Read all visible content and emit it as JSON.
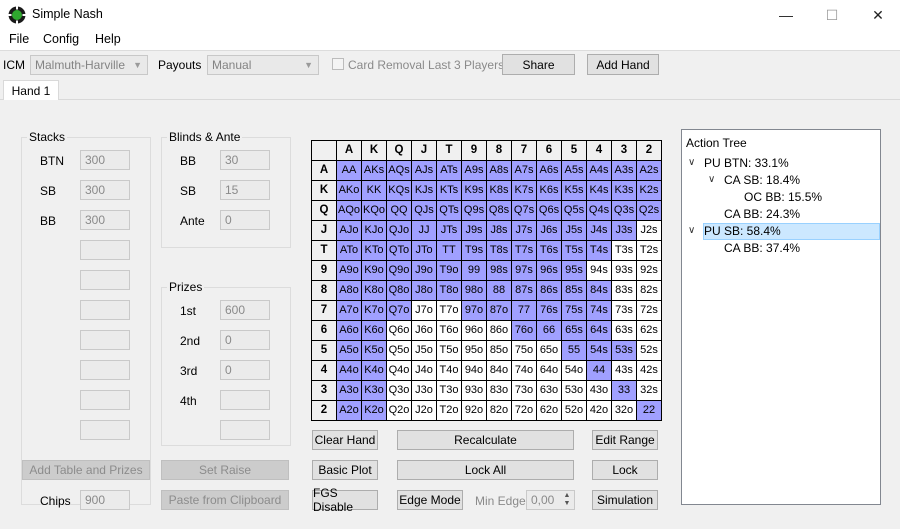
{
  "window": {
    "title": "Simple Nash",
    "minimize": "—",
    "maximize": "☐",
    "close": "✕"
  },
  "menu": [
    "File",
    "Config",
    "Help"
  ],
  "toolbar": {
    "icm_label": "ICM",
    "icm_value": "Malmuth-Harville",
    "payouts_label": "Payouts",
    "payouts_value": "Manual",
    "card_removal_label": "Card Removal Last 3 Players",
    "card_removal_checked": false,
    "share_label": "Share",
    "add_hand_label": "Add Hand"
  },
  "tabs": [
    "Hand 1"
  ],
  "stacks": {
    "title": "Stacks",
    "rows": [
      {
        "label": "BTN",
        "value": "300"
      },
      {
        "label": "SB",
        "value": "300"
      },
      {
        "label": "BB",
        "value": "300"
      },
      {
        "label": "",
        "value": ""
      },
      {
        "label": "",
        "value": ""
      },
      {
        "label": "",
        "value": ""
      },
      {
        "label": "",
        "value": ""
      },
      {
        "label": "",
        "value": ""
      },
      {
        "label": "",
        "value": ""
      },
      {
        "label": "",
        "value": ""
      }
    ]
  },
  "blinds": {
    "title": "Blinds & Ante",
    "rows": [
      {
        "label": "BB",
        "value": "30"
      },
      {
        "label": "SB",
        "value": "15"
      },
      {
        "label": "Ante",
        "value": "0"
      }
    ]
  },
  "prizes": {
    "title": "Prizes",
    "rows": [
      {
        "label": "1st",
        "value": "600"
      },
      {
        "label": "2nd",
        "value": "0"
      },
      {
        "label": "3rd",
        "value": "0"
      },
      {
        "label": "4th",
        "value": ""
      },
      {
        "label": "",
        "value": ""
      }
    ]
  },
  "left_buttons": {
    "add_table": "Add Table and Prizes",
    "set_raise": "Set Raise",
    "chips_label": "Chips",
    "chips_value": "900",
    "paste": "Paste from Clipboard"
  },
  "grid": {
    "ranks": [
      "A",
      "K",
      "Q",
      "J",
      "T",
      "9",
      "8",
      "7",
      "6",
      "5",
      "4",
      "3",
      "2"
    ],
    "cells": [
      [
        "AA",
        "AKs",
        "AQs",
        "AJs",
        "ATs",
        "A9s",
        "A8s",
        "A7s",
        "A6s",
        "A5s",
        "A4s",
        "A3s",
        "A2s"
      ],
      [
        "AKo",
        "KK",
        "KQs",
        "KJs",
        "KTs",
        "K9s",
        "K8s",
        "K7s",
        "K6s",
        "K5s",
        "K4s",
        "K3s",
        "K2s"
      ],
      [
        "AQo",
        "KQo",
        "QQ",
        "QJs",
        "QTs",
        "Q9s",
        "Q8s",
        "Q7s",
        "Q6s",
        "Q5s",
        "Q4s",
        "Q3s",
        "Q2s"
      ],
      [
        "AJo",
        "KJo",
        "QJo",
        "JJ",
        "JTs",
        "J9s",
        "J8s",
        "J7s",
        "J6s",
        "J5s",
        "J4s",
        "J3s",
        "J2s"
      ],
      [
        "ATo",
        "KTo",
        "QTo",
        "JTo",
        "TT",
        "T9s",
        "T8s",
        "T7s",
        "T6s",
        "T5s",
        "T4s",
        "T3s",
        "T2s"
      ],
      [
        "A9o",
        "K9o",
        "Q9o",
        "J9o",
        "T9o",
        "99",
        "98s",
        "97s",
        "96s",
        "95s",
        "94s",
        "93s",
        "92s"
      ],
      [
        "A8o",
        "K8o",
        "Q8o",
        "J8o",
        "T8o",
        "98o",
        "88",
        "87s",
        "86s",
        "85s",
        "84s",
        "83s",
        "82s"
      ],
      [
        "A7o",
        "K7o",
        "Q7o",
        "J7o",
        "T7o",
        "97o",
        "87o",
        "77",
        "76s",
        "75s",
        "74s",
        "73s",
        "72s"
      ],
      [
        "A6o",
        "K6o",
        "Q6o",
        "J6o",
        "T6o",
        "96o",
        "86o",
        "76o",
        "66",
        "65s",
        "64s",
        "63s",
        "62s"
      ],
      [
        "A5o",
        "K5o",
        "Q5o",
        "J5o",
        "T5o",
        "95o",
        "85o",
        "75o",
        "65o",
        "55",
        "54s",
        "53s",
        "52s"
      ],
      [
        "A4o",
        "K4o",
        "Q4o",
        "J4o",
        "T4o",
        "94o",
        "84o",
        "74o",
        "64o",
        "54o",
        "44",
        "43s",
        "42s"
      ],
      [
        "A3o",
        "K3o",
        "Q3o",
        "J3o",
        "T3o",
        "93o",
        "83o",
        "73o",
        "63o",
        "53o",
        "43o",
        "33",
        "32s"
      ],
      [
        "A2o",
        "K2o",
        "Q2o",
        "J2o",
        "T2o",
        "92o",
        "82o",
        "72o",
        "62o",
        "52o",
        "42o",
        "32o",
        "22"
      ]
    ],
    "selected": [
      [
        1,
        1,
        1,
        1,
        1,
        1,
        1,
        1,
        1,
        1,
        1,
        1,
        1
      ],
      [
        1,
        1,
        1,
        1,
        1,
        1,
        1,
        1,
        1,
        1,
        1,
        1,
        1
      ],
      [
        1,
        1,
        1,
        1,
        1,
        1,
        1,
        1,
        1,
        1,
        1,
        1,
        1
      ],
      [
        1,
        1,
        1,
        1,
        1,
        1,
        1,
        1,
        1,
        1,
        1,
        1,
        0
      ],
      [
        1,
        1,
        1,
        1,
        1,
        1,
        1,
        1,
        1,
        1,
        1,
        0,
        0
      ],
      [
        1,
        1,
        1,
        1,
        1,
        1,
        1,
        1,
        1,
        1,
        0,
        0,
        0
      ],
      [
        1,
        1,
        1,
        1,
        1,
        1,
        1,
        1,
        1,
        1,
        1,
        0,
        0
      ],
      [
        1,
        1,
        1,
        0,
        0,
        1,
        1,
        1,
        1,
        1,
        1,
        0,
        0
      ],
      [
        1,
        1,
        0,
        0,
        0,
        0,
        0,
        1,
        1,
        1,
        1,
        0,
        0
      ],
      [
        1,
        1,
        0,
        0,
        0,
        0,
        0,
        0,
        0,
        1,
        1,
        1,
        0
      ],
      [
        1,
        1,
        0,
        0,
        0,
        0,
        0,
        0,
        0,
        0,
        1,
        0,
        0
      ],
      [
        1,
        1,
        0,
        0,
        0,
        0,
        0,
        0,
        0,
        0,
        0,
        1,
        0
      ],
      [
        1,
        1,
        0,
        0,
        0,
        0,
        0,
        0,
        0,
        0,
        0,
        0,
        1
      ]
    ],
    "on_color": "#a0a0ff",
    "off_color": "#ffffff"
  },
  "grid_buttons": {
    "clear_hand": "Clear Hand",
    "recalculate": "Recalculate",
    "edit_range": "Edit Range",
    "basic_plot": "Basic Plot",
    "lock_all": "Lock All",
    "lock": "Lock",
    "fgs_disable": "FGS Disable",
    "edge_mode": "Edge Mode",
    "min_edge_label": "Min Edge",
    "min_edge_value": "0,00",
    "simulation": "Simulation"
  },
  "action_tree": {
    "title": "Action Tree",
    "nodes": [
      {
        "text": "PU BTN: 33.1%",
        "expanded": true,
        "depth": 0
      },
      {
        "text": "CA SB: 18.4%",
        "expanded": true,
        "depth": 1
      },
      {
        "text": "OC BB: 15.5%",
        "depth": 2
      },
      {
        "text": "CA BB: 24.3%",
        "depth": 1
      },
      {
        "text": "PU SB: 58.4%",
        "expanded": true,
        "depth": 0,
        "selected": true
      },
      {
        "text": "CA BB: 37.4%",
        "depth": 1
      }
    ]
  }
}
